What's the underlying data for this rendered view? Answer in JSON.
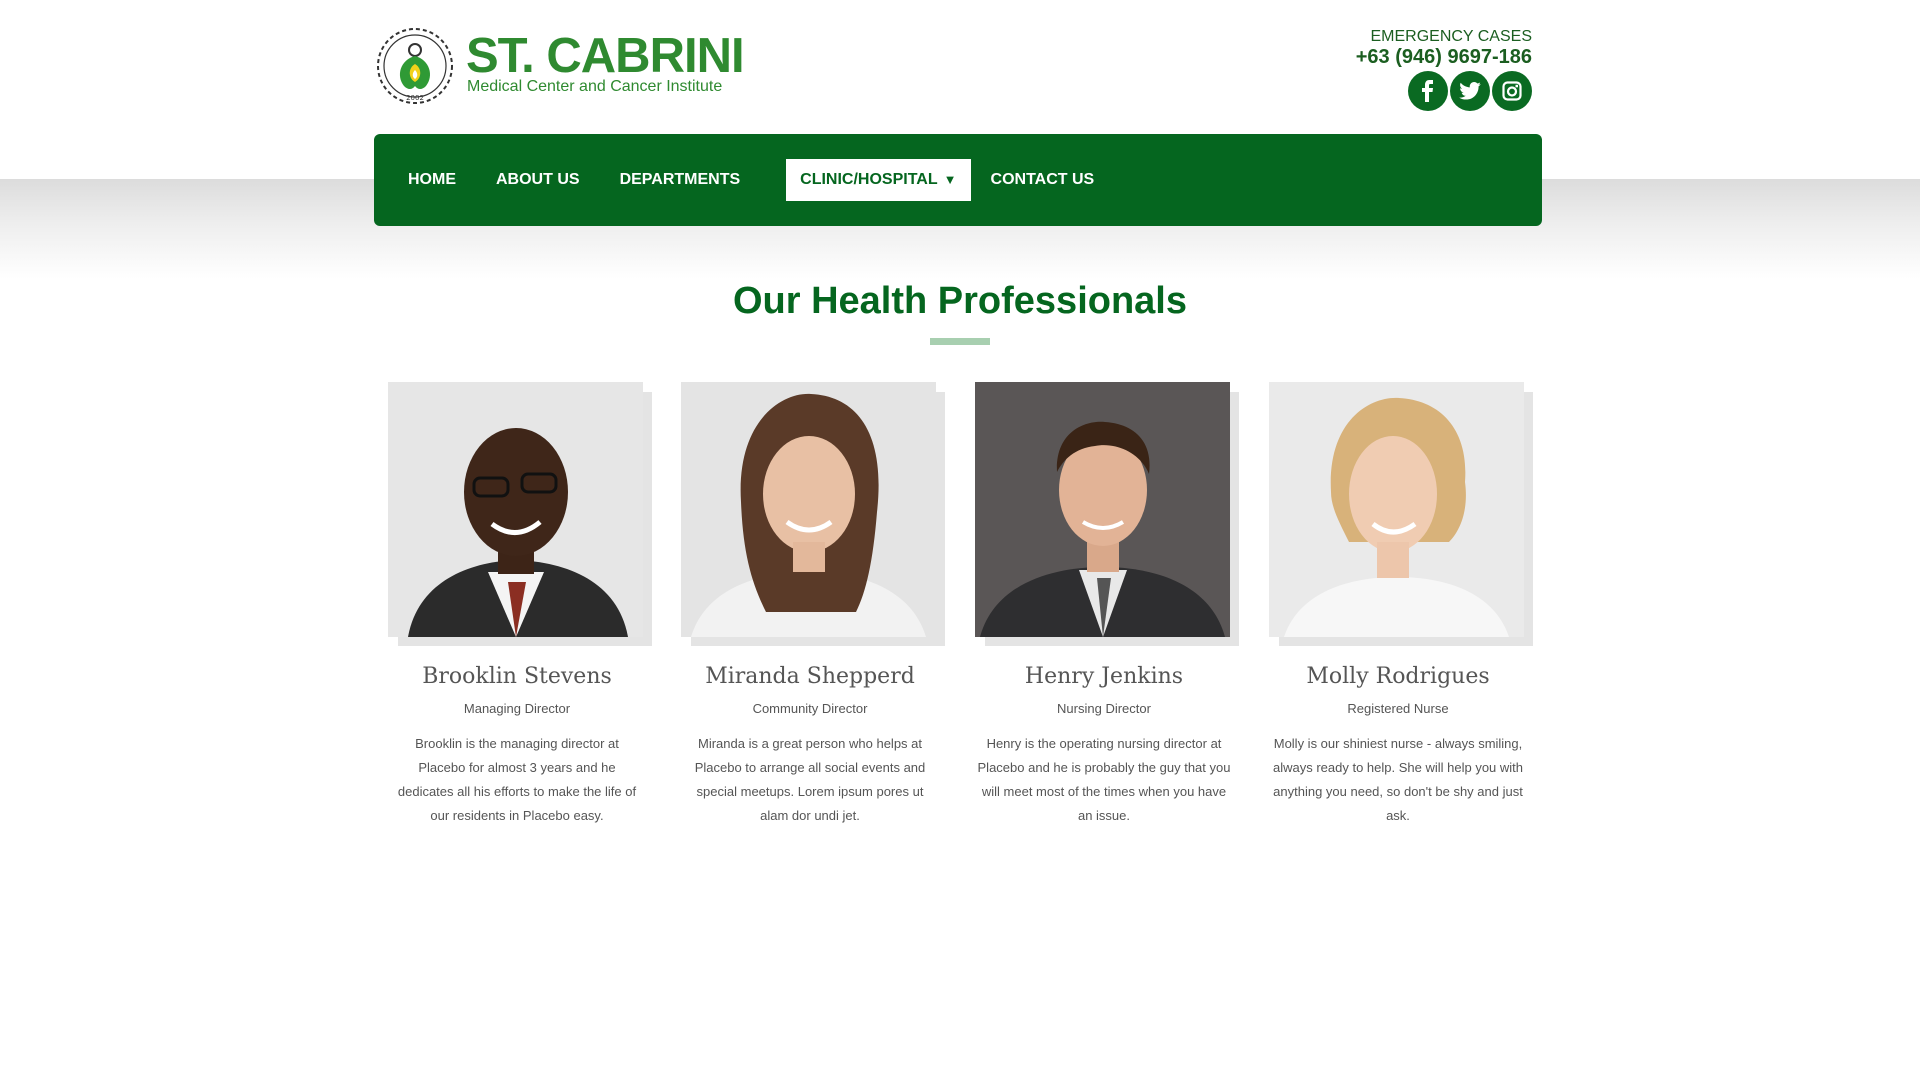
{
  "brand": {
    "name": "ST. CABRINI",
    "tagline": "Medical Center and Cancer Institute",
    "emblem_year": "2002"
  },
  "emergency": {
    "label": "EMERGENCY CASES",
    "phone": "+63 (946) 9697-186"
  },
  "socials": [
    {
      "icon": "facebook-icon"
    },
    {
      "icon": "twitter-icon"
    },
    {
      "icon": "instagram-icon"
    }
  ],
  "nav": {
    "items": [
      {
        "label": "HOME"
      },
      {
        "label": "ABOUT US"
      },
      {
        "label": "DEPARTMENTS"
      },
      {
        "label": "CLINIC/HOSPITAL",
        "active": true
      },
      {
        "label": "CONTACT US"
      }
    ],
    "caret": "▼"
  },
  "section": {
    "title": "Our Health Professionals"
  },
  "team": [
    {
      "name": "Brooklin Stevens",
      "role": "Managing Director",
      "bio": "Brooklin is the managing director at Placebo for almost 3 years and he dedicates all his efforts to make the life of our residents in Placebo easy."
    },
    {
      "name": "Miranda Shepperd",
      "role": "Community Director",
      "bio": "Miranda is a great person who helps at Placebo to arrange all social events and special meetups. Lorem ipsum pores ut alam dor undi jet."
    },
    {
      "name": "Henry Jenkins",
      "role": "Nursing Director",
      "bio": "Henry is the operating nursing director at Placebo and he is probably the guy that you will meet most of the times when you have an issue."
    },
    {
      "name": "Molly Rodrigues",
      "role": "Registered Nurse",
      "bio": "Molly is our shiniest nurse - always smiling, always ready to help. She will help you with anything you need, so don't be shy and just ask."
    }
  ],
  "colors": {
    "brand_green": "#2f8a30",
    "nav_green": "#05661f",
    "rule_green": "#a8cfb0"
  }
}
